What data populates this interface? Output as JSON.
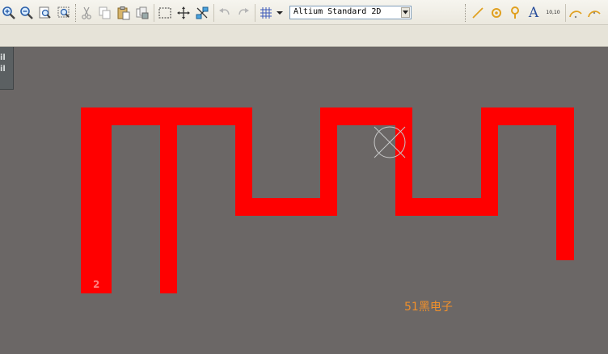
{
  "toolbar": {
    "buttons": [
      {
        "name": "zoom-in-icon"
      },
      {
        "name": "zoom-out-icon"
      },
      {
        "name": "zoom-fit-document-icon"
      },
      {
        "name": "zoom-area-icon"
      },
      {
        "name": "cut-icon"
      },
      {
        "name": "copy-icon"
      },
      {
        "name": "paste-icon"
      },
      {
        "name": "rubber-stamp-icon"
      },
      {
        "name": "select-area-icon"
      },
      {
        "name": "move-icon"
      },
      {
        "name": "select-cross-icon"
      },
      {
        "name": "undo-icon"
      },
      {
        "name": "redo-icon"
      },
      {
        "name": "grid-icon"
      }
    ],
    "view_combo": {
      "value": "Altium Standard 2D"
    },
    "place_tools": [
      {
        "name": "line-icon"
      },
      {
        "name": "pad-icon"
      },
      {
        "name": "via-icon"
      },
      {
        "name": "string-icon"
      },
      {
        "name": "coordinate-icon"
      },
      {
        "name": "arc-center-icon"
      },
      {
        "name": "arc-edge-icon"
      }
    ],
    "string_icon_text": "A",
    "coordinate_icon_text": "10,10"
  },
  "side_panel": {
    "tab_lines": [
      "il",
      "il"
    ]
  },
  "pcb": {
    "trace_color": "#ff0000",
    "background_color": "#6b6766",
    "pad_label": "2"
  },
  "watermark": "51黑电子"
}
